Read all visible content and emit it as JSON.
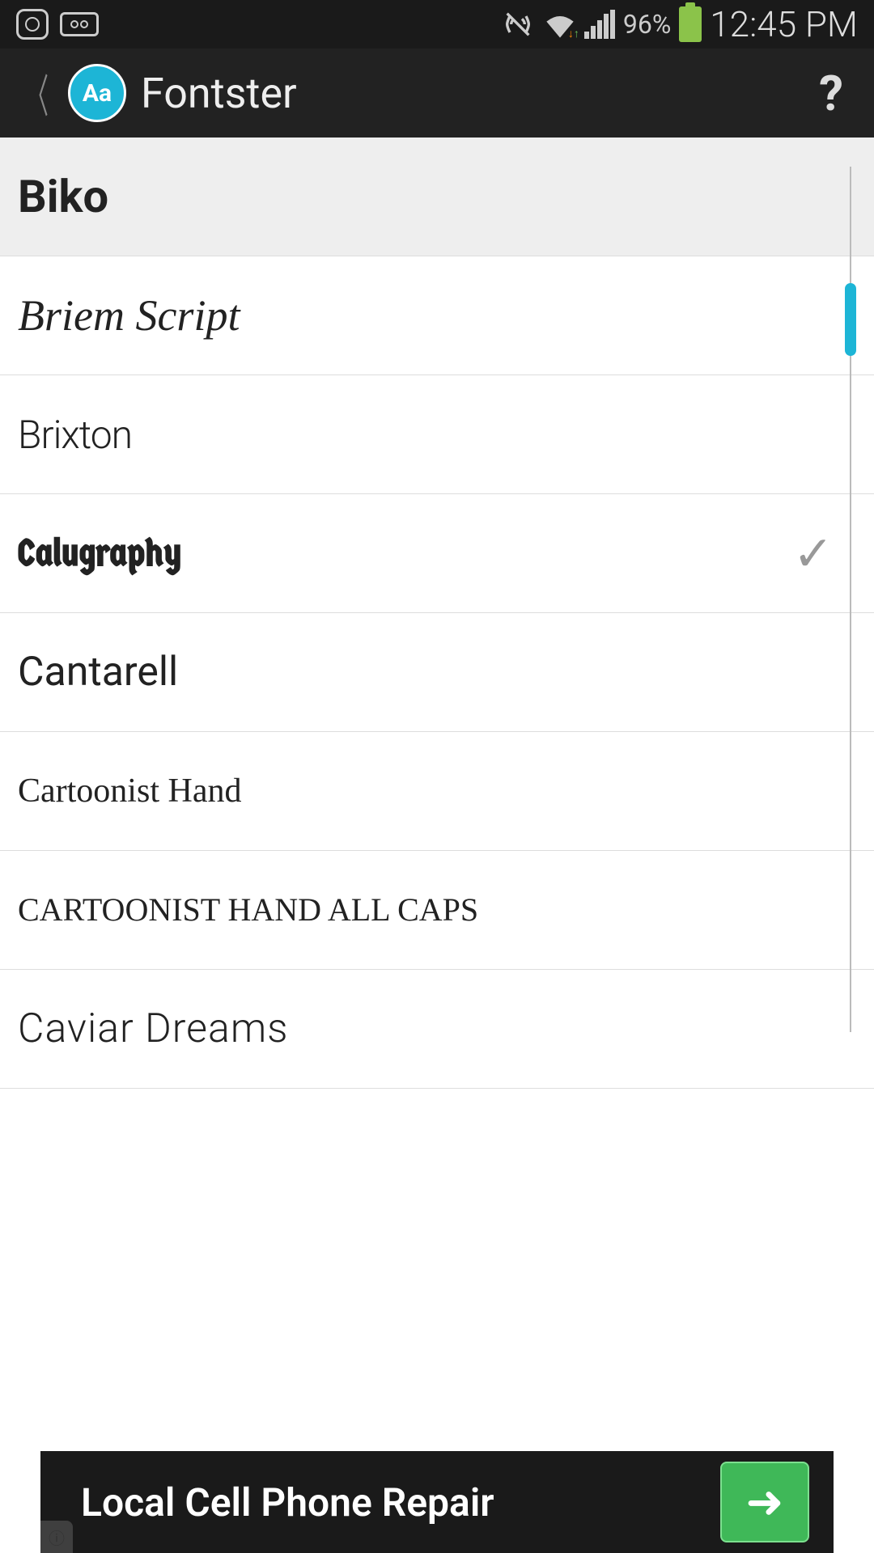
{
  "status": {
    "battery_pct": "96%",
    "time": "12:45 PM"
  },
  "appbar": {
    "logo_text": "Aa",
    "title": "Fontster"
  },
  "fonts": [
    {
      "name": "Biko",
      "style": "biko",
      "checked": false
    },
    {
      "name": "Briem Script",
      "style": "briem",
      "checked": false
    },
    {
      "name": "Brixton",
      "style": "brixton",
      "checked": false
    },
    {
      "name": "Calugraphy",
      "style": "calugraphy",
      "checked": true
    },
    {
      "name": "Cantarell",
      "style": "cantarell",
      "checked": false
    },
    {
      "name": "Cartoonist Hand",
      "style": "cartoonist",
      "checked": false
    },
    {
      "name": "CARTOONIST HAND ALL CAPS",
      "style": "cartoonist-caps",
      "checked": false
    },
    {
      "name": "Caviar Dreams",
      "style": "caviar",
      "checked": false
    }
  ],
  "ad": {
    "text": "Local Cell Phone Repair",
    "info": "i"
  }
}
